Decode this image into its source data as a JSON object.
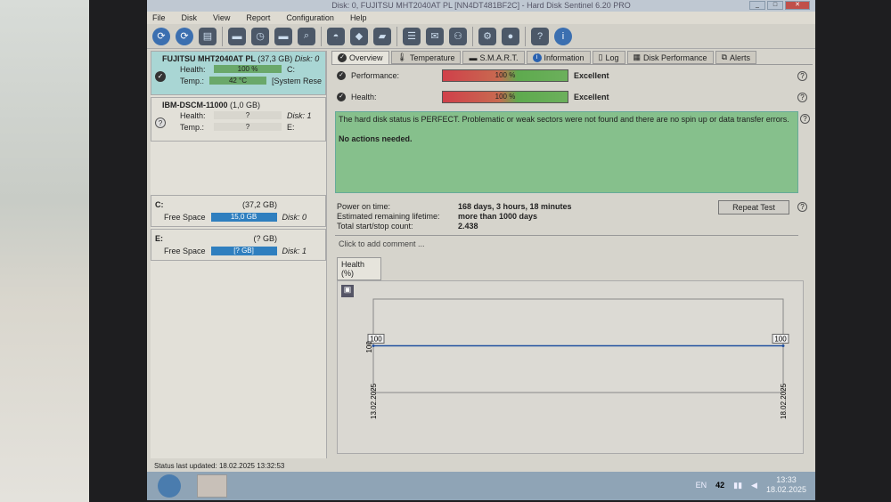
{
  "window": {
    "title": "Disk: 0, FUJITSU MHT2040AT PL [NN4DT481BF2C]  -  Hard Disk Sentinel 6.20 PRO"
  },
  "menu": [
    "File",
    "Disk",
    "View",
    "Report",
    "Configuration",
    "Help"
  ],
  "disks": [
    {
      "name": "FUJITSU MHT2040AT PL",
      "size": "(37,3 GB)",
      "disk": "Disk: 0",
      "health_label": "Health:",
      "health": "100 %",
      "temp_label": "Temp.:",
      "temp": "42 °C",
      "vol": "C:",
      "vol2": "[System Rese"
    },
    {
      "name": "IBM-DSCM-11000",
      "size": "(1,0 GB)",
      "disk": "Disk: 1",
      "health_label": "Health:",
      "health": "?",
      "temp_label": "Temp.:",
      "temp": "?",
      "vol": "E:"
    }
  ],
  "volumes": [
    {
      "letter": "C:",
      "size": "(37,2 GB)",
      "free_label": "Free Space",
      "free": "15,0 GB",
      "disk": "Disk: 0"
    },
    {
      "letter": "E:",
      "size": "(? GB)",
      "free_label": "Free Space",
      "free": "[? GB]",
      "disk": "Disk: 1"
    }
  ],
  "tabs": [
    "Overview",
    "Temperature",
    "S.M.A.R.T.",
    "Information",
    "Log",
    "Disk Performance",
    "Alerts"
  ],
  "overview": {
    "performance_label": "Performance:",
    "performance": "100 %",
    "performance_rating": "Excellent",
    "health_label": "Health:",
    "health": "100 %",
    "health_rating": "Excellent",
    "status_text": "The hard disk status is PERFECT. Problematic or weak sectors were not found and there are no spin up or data transfer errors.",
    "actions": "No actions needed.",
    "power_on_label": "Power on time:",
    "power_on": "168 days, 3 hours, 18 minutes",
    "lifetime_label": "Estimated remaining lifetime:",
    "lifetime": "more than 1000 days",
    "startstop_label": "Total start/stop count:",
    "startstop": "2.438",
    "repeat_test": "Repeat Test",
    "comment": "Click to add comment ...",
    "health_tab": "Health (%)"
  },
  "chart_data": {
    "type": "line",
    "title": "Health (%)",
    "x": [
      "13.02.2025",
      "18.02.2025"
    ],
    "values": [
      100,
      100
    ],
    "point_labels": [
      "100",
      "100"
    ],
    "ylabel_tick": "100"
  },
  "statusbar": "Status last updated: 18.02.2025 13:32:53",
  "tray": {
    "lang": "EN",
    "temp": "42",
    "time": "13:33",
    "date": "18.02.2025"
  }
}
